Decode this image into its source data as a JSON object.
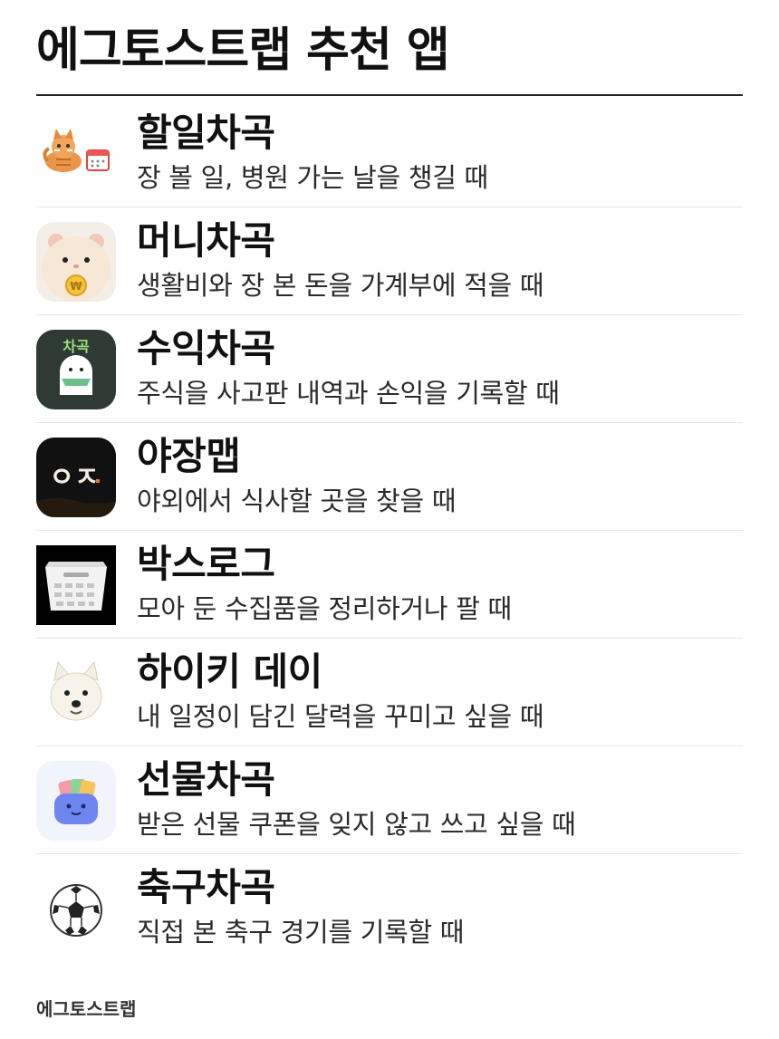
{
  "header": {
    "title": "에그토스트랩 추천 앱"
  },
  "apps": [
    {
      "name": "할일차곡",
      "desc": "장 볼 일, 병원 가는 날을 챙길 때",
      "icon": "cat-calendar-icon"
    },
    {
      "name": "머니차곡",
      "desc": "생활비와 장 본 돈을 가계부에 적을 때",
      "icon": "hamster-coin-icon"
    },
    {
      "name": "수익차곡",
      "desc": "주식을 사고판 내역과 손익을 기록할 때",
      "icon": "ghost-chagok-icon",
      "icon_text": "차곡"
    },
    {
      "name": "야장맵",
      "desc": "야외에서 식사할 곳을 찾을 때",
      "icon": "yajang-logo-icon",
      "icon_text": "ㅇㅈ"
    },
    {
      "name": "박스로그",
      "desc": "모아 둔 수집품을 정리하거나 팔 때",
      "icon": "storage-basket-icon"
    },
    {
      "name": "하이키 데이",
      "desc": "내 일정이 담긴 달력을 꾸미고 싶을 때",
      "icon": "westie-dog-icon"
    },
    {
      "name": "선물차곡",
      "desc": "받은 선물 쿠폰을 잊지 않고 쓰고 싶을 때",
      "icon": "gift-pocket-icon"
    },
    {
      "name": "축구차곡",
      "desc": "직접 본 축구 경기를 기록할 때",
      "icon": "soccer-ball-icon"
    }
  ],
  "footer": {
    "brand": "에그토스트랩"
  },
  "colors": {
    "title_rule": "#222222",
    "divider": "#e6e6e6",
    "chagok_green": "#9be07a",
    "icon_dark": "#2f3a34"
  }
}
